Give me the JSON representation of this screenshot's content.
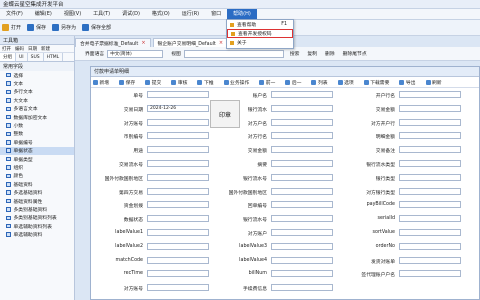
{
  "app": {
    "title": "金蝶云星空集成开发平台"
  },
  "menu": {
    "items": [
      "文件(F)",
      "编辑(E)",
      "视图(V)",
      "工具(T)",
      "调试(D)",
      "格式(O)",
      "运行(R)",
      "窗口",
      "帮助(H)"
    ],
    "active_index": 8
  },
  "help_menu": {
    "items": [
      {
        "label": "查看帮助",
        "shortcut": "F1"
      },
      {
        "label": "查看开发授权码",
        "shortcut": ""
      },
      {
        "label": "关于",
        "shortcut": ""
      }
    ]
  },
  "toolbar": {
    "items": [
      "打开",
      "保存",
      "另存为",
      "保存全部"
    ]
  },
  "tabs": [
    {
      "label": "合并电子票据标准_Default"
    },
    {
      "label": "银企账户交易明细_Default"
    }
  ],
  "filter": {
    "lang_label": "界面语言",
    "lang_value": "中文(简体)",
    "view_label": "视图",
    "search_label": "搜索",
    "copy_label": "复制",
    "del_label": "删除",
    "ver_label": "删除尾节点"
  },
  "sidebar": {
    "title": "工具箱",
    "tools": [
      "打开",
      "编码",
      "日期",
      "新建"
    ],
    "tabs": [
      "分组",
      "UI",
      "SUS",
      "HTML"
    ],
    "section": "常用字段",
    "items": [
      "选择",
      "文本",
      "多行文本",
      "大文本",
      "多语言文本",
      "数据库加密文本",
      "小数",
      "整数",
      "单据编号",
      "单据状态",
      "单据类型",
      "组织",
      "颜色",
      "基础资料",
      "多选基础资料",
      "基础资料属性",
      "多类别基础资料",
      "多类别基础资料列表",
      "单选辅助资料列表",
      "单选辅助资料"
    ],
    "selected_index": 9
  },
  "form": {
    "title": "付款申请单明细",
    "tools": [
      "新增",
      "保存",
      "提交",
      "审核",
      "下推",
      "业务操作",
      "前一",
      "后一",
      "列表",
      "选项",
      "下载需要",
      "导出",
      "刷新"
    ],
    "fields": {
      "c1": [
        "单号",
        "交易日期",
        "对方账号",
        "币别编号",
        "用途",
        "交易流水号",
        "国外付款国别地区",
        "第四方交易",
        "资金划拨",
        "数据状态",
        "labelValue1",
        "labelValue2",
        "matchCode",
        "recTime",
        "对方账号"
      ],
      "c2": [
        "账户名",
        "银行流水",
        "对方户名",
        "对方行名",
        "交易金额",
        "摘要",
        "银行流水号",
        "国外付款国别地区",
        "回单编号",
        "银行流水号",
        "对方账户",
        "labelValue3",
        "labelValue4",
        "billNum",
        "手续费信息"
      ],
      "c3": [
        "开户行名",
        "交易金额",
        "对方开户行",
        "明细金额",
        "交易备注",
        "银行流水类型",
        "银行类型",
        "对方银行类型",
        "payBillCode",
        "serialId",
        "sortValue",
        "orderNo",
        "发货对账单",
        "签代理账户户名"
      ]
    },
    "date_value": "2024-12-26",
    "stamp_label": "印章"
  }
}
